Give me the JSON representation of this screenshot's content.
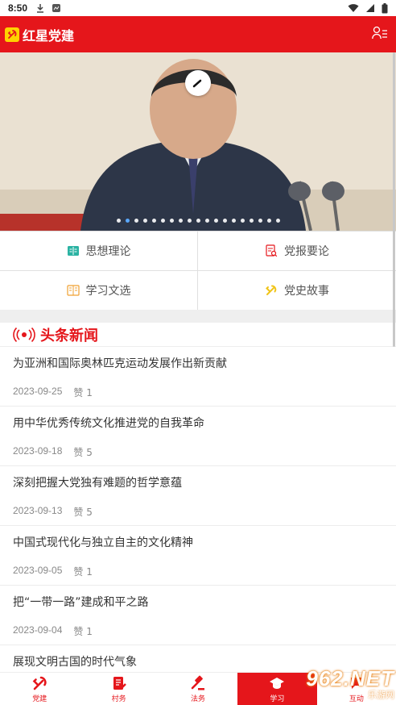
{
  "status": {
    "time": "8:50"
  },
  "app": {
    "title": "红星党建"
  },
  "categories": [
    {
      "label": "思想理论",
      "icon": "book-icon",
      "color": "#2bb3a3"
    },
    {
      "label": "党报要论",
      "icon": "document-search-icon",
      "color": "#e5161b"
    },
    {
      "label": "学习文选",
      "icon": "open-book-icon",
      "color": "#f0a030"
    },
    {
      "label": "党史故事",
      "icon": "party-emblem-icon",
      "color": "#f0c419"
    }
  ],
  "headline": {
    "title": "头条新闻"
  },
  "news": [
    {
      "title": "为亚洲和国际奥林匹克运动发展作出新贡献",
      "date": "2023-09-25",
      "likes": "赞 1"
    },
    {
      "title": "用中华优秀传统文化推进党的自我革命",
      "date": "2023-09-18",
      "likes": "赞 5"
    },
    {
      "title": "深刻把握大党独有难题的哲学意蕴",
      "date": "2023-09-13",
      "likes": "赞 5"
    },
    {
      "title": "中国式现代化与独立自主的文化精神",
      "date": "2023-09-05",
      "likes": "赞 1"
    },
    {
      "title": "把“一带一路”建成和平之路",
      "date": "2023-09-04",
      "likes": "赞 1"
    },
    {
      "title": "展现文明古国的时代气象",
      "date": "",
      "likes": ""
    }
  ],
  "tabs": [
    {
      "label": "党建",
      "icon": "party-emblem-icon"
    },
    {
      "label": "村务",
      "icon": "document-edit-icon"
    },
    {
      "label": "法务",
      "icon": "gavel-icon"
    },
    {
      "label": "学习",
      "icon": "graduation-cap-icon",
      "active": true
    },
    {
      "label": "互动",
      "icon": "chat-icon"
    }
  ],
  "watermark": {
    "big": "962.NET",
    "small": "乐游网"
  },
  "colors": {
    "brand": "#e5161b",
    "accent_dot": "#5aa8ff"
  }
}
